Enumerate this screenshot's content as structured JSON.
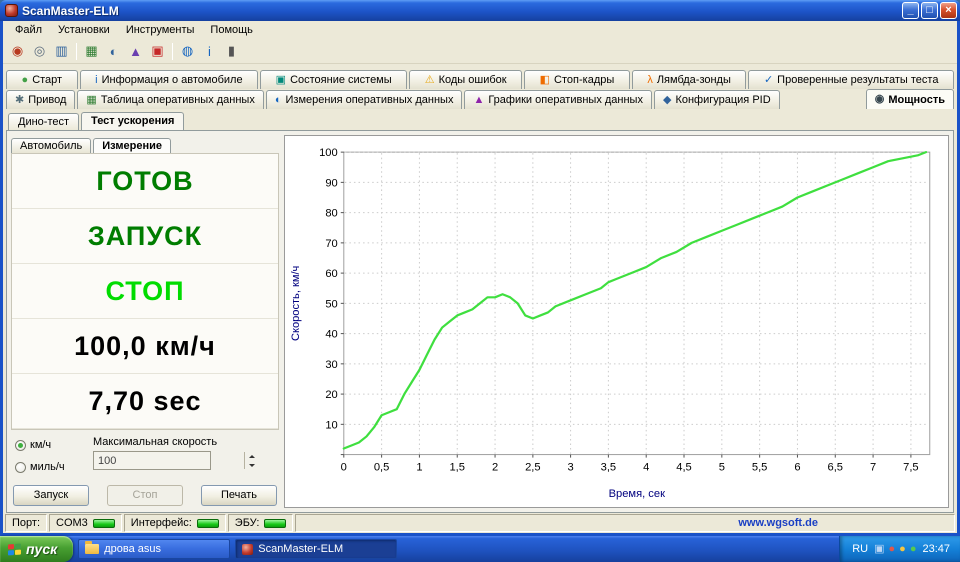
{
  "window": {
    "title": "ScanMaster-ELM"
  },
  "menu": {
    "items": [
      "Файл",
      "Установки",
      "Инструменты",
      "Помощь"
    ]
  },
  "toolbar": {
    "icons": [
      {
        "name": "connect-icon",
        "glyph": "◉",
        "color": "#b8391f"
      },
      {
        "name": "disconnect-icon",
        "glyph": "◎",
        "color": "#5a6b7d"
      },
      {
        "name": "ecu-read-icon",
        "glyph": "▥",
        "color": "#31639c"
      },
      {
        "name": "separator"
      },
      {
        "name": "live-table-icon",
        "glyph": "▦",
        "color": "#2e7d32"
      },
      {
        "name": "gauges-icon",
        "glyph": "◐",
        "color": "#31639c"
      },
      {
        "name": "graphs-icon",
        "glyph": "▲",
        "color": "#6a3fb0"
      },
      {
        "name": "dtc-icon",
        "glyph": "▣",
        "color": "#c62828"
      },
      {
        "name": "separator"
      },
      {
        "name": "globe-icon",
        "glyph": "◍",
        "color": "#1565c0"
      },
      {
        "name": "info-icon",
        "glyph": "i",
        "color": "#1565c0"
      },
      {
        "name": "exit-icon",
        "glyph": "▮",
        "color": "#555555"
      }
    ]
  },
  "tabs": {
    "row1": [
      {
        "label": "Старт",
        "icon": "start-icon",
        "glyph": "●",
        "color": "#43a047",
        "active": false
      },
      {
        "label": "Информация о автомобиле",
        "icon": "car-info-icon",
        "glyph": "i",
        "color": "#1565c0",
        "active": false
      },
      {
        "label": "Состояние системы",
        "icon": "system-status-icon",
        "glyph": "▣",
        "color": "#00897b",
        "active": false
      },
      {
        "label": "Коды ошибок",
        "icon": "error-codes-icon",
        "glyph": "⚠",
        "color": "#e6a817",
        "active": false
      },
      {
        "label": "Стоп-кадры",
        "icon": "freeze-frames-icon",
        "glyph": "◧",
        "color": "#ef6c00",
        "active": false
      },
      {
        "label": "Лямбда-зонды",
        "icon": "lambda-sensors-icon",
        "glyph": "λ",
        "color": "#ef6c00",
        "active": false
      },
      {
        "label": "Проверенные результаты теста",
        "icon": "test-results-icon",
        "glyph": "✓",
        "color": "#1565c0",
        "active": false
      }
    ],
    "row2": [
      {
        "label": "Привод",
        "icon": "drive-icon",
        "glyph": "✱",
        "color": "#546e7a",
        "active": false
      },
      {
        "label": "Таблица оперативных данных",
        "icon": "live-data-table-icon",
        "glyph": "▦",
        "color": "#2e7d32",
        "active": false
      },
      {
        "label": "Измерения оперативных данных",
        "icon": "live-data-meters-icon",
        "glyph": "◐",
        "color": "#1565c0",
        "active": false
      },
      {
        "label": "Графики оперативных данных",
        "icon": "live-data-graphs-icon",
        "glyph": "▲",
        "color": "#8e24aa",
        "active": false
      },
      {
        "label": "Конфигурация PID",
        "icon": "pid-config-icon",
        "glyph": "◆",
        "color": "#31639c",
        "active": false
      },
      {
        "label": "Мощность",
        "icon": "power-icon",
        "glyph": "◉",
        "color": "#37474f",
        "active": true
      }
    ]
  },
  "inner_tabs": [
    {
      "label": "Дино-тест",
      "active": false
    },
    {
      "label": "Тест ускорения",
      "active": true
    }
  ],
  "left_panel": {
    "tabs": [
      {
        "label": "Автомобиль",
        "active": false
      },
      {
        "label": "Измерение",
        "active": true
      }
    ],
    "ready_label": "ГОТОВ",
    "start_label": "ЗАПУСК",
    "stop_label": "СТОП",
    "speed_readout": "100,0 км/ч",
    "time_readout": "7,70 sec",
    "unit_options": [
      {
        "label": "км/ч",
        "selected": true
      },
      {
        "label": "миль/ч",
        "selected": false
      }
    ],
    "max_speed_label": "Максимальная скорость",
    "max_speed_value": "100",
    "buttons": [
      {
        "label": "Запуск",
        "enabled": true
      },
      {
        "label": "Стоп",
        "enabled": false
      },
      {
        "label": "Печать",
        "enabled": true
      }
    ]
  },
  "chart_data": {
    "type": "line",
    "title": "",
    "xlabel": "Время, сек",
    "ylabel": "Скорость, км/ч",
    "xlim": [
      0,
      7.75
    ],
    "ylim": [
      0,
      100
    ],
    "x_ticks": [
      0,
      0.5,
      1,
      1.5,
      2,
      2.5,
      3,
      3.5,
      4,
      4.5,
      5,
      5.5,
      6,
      6.5,
      7,
      7.5
    ],
    "x_tick_labels": [
      "0",
      "0,5",
      "1",
      "1,5",
      "2",
      "2,5",
      "3",
      "3,5",
      "4",
      "4,5",
      "5",
      "5,5",
      "6",
      "6,5",
      "7",
      "7,5"
    ],
    "y_ticks": [
      0,
      10,
      20,
      30,
      40,
      50,
      60,
      70,
      80,
      90,
      100
    ],
    "grid": true,
    "legend": false,
    "line_color": "#3fdf3f",
    "series": [
      {
        "name": "Скорость, км/ч",
        "x": [
          0,
          0.1,
          0.2,
          0.3,
          0.4,
          0.5,
          0.6,
          0.7,
          0.8,
          0.9,
          1.0,
          1.1,
          1.2,
          1.3,
          1.4,
          1.5,
          1.6,
          1.7,
          1.8,
          1.9,
          2.0,
          2.1,
          2.2,
          2.3,
          2.4,
          2.5,
          2.6,
          2.7,
          2.8,
          3.0,
          3.2,
          3.4,
          3.5,
          3.6,
          3.8,
          4.0,
          4.2,
          4.4,
          4.6,
          4.8,
          5.0,
          5.2,
          5.4,
          5.6,
          5.8,
          6.0,
          6.2,
          6.4,
          6.6,
          6.8,
          7.0,
          7.2,
          7.4,
          7.6,
          7.7
        ],
        "y": [
          2,
          3,
          4,
          6,
          9,
          13,
          14,
          15,
          20,
          24,
          28,
          33,
          38,
          42,
          44,
          46,
          47,
          48,
          50,
          52,
          52,
          53,
          52,
          50,
          46,
          45,
          46,
          47,
          49,
          51,
          53,
          55,
          57,
          58,
          60,
          62,
          65,
          67,
          70,
          72,
          74,
          76,
          78,
          80,
          82,
          85,
          87,
          89,
          91,
          93,
          95,
          97,
          98,
          99,
          100
        ]
      }
    ]
  },
  "statusbar": {
    "port_label": "Порт:",
    "port_value": "COM3",
    "interface_label": "Интерфейс:",
    "ecu_label": "ЭБУ:",
    "led_color": "#19c919",
    "website": "www.wgsoft.de"
  },
  "taskbar": {
    "start_label": "пуск",
    "tasks": [
      {
        "label": "дрова asus",
        "icon": "folder-icon",
        "active": false
      },
      {
        "label": "ScanMaster-ELM",
        "icon": "scanmaster-icon",
        "active": true
      }
    ],
    "tray": {
      "language": "RU",
      "time": "23:47",
      "icons": [
        {
          "name": "display-icon",
          "glyph": "▣",
          "color": "#bcd6f5"
        },
        {
          "name": "messenger-icon",
          "glyph": "●",
          "color": "#e0574a"
        },
        {
          "name": "update-icon",
          "glyph": "●",
          "color": "#f5c542"
        },
        {
          "name": "antivirus-icon",
          "glyph": "●",
          "color": "#57c94f"
        }
      ]
    }
  }
}
